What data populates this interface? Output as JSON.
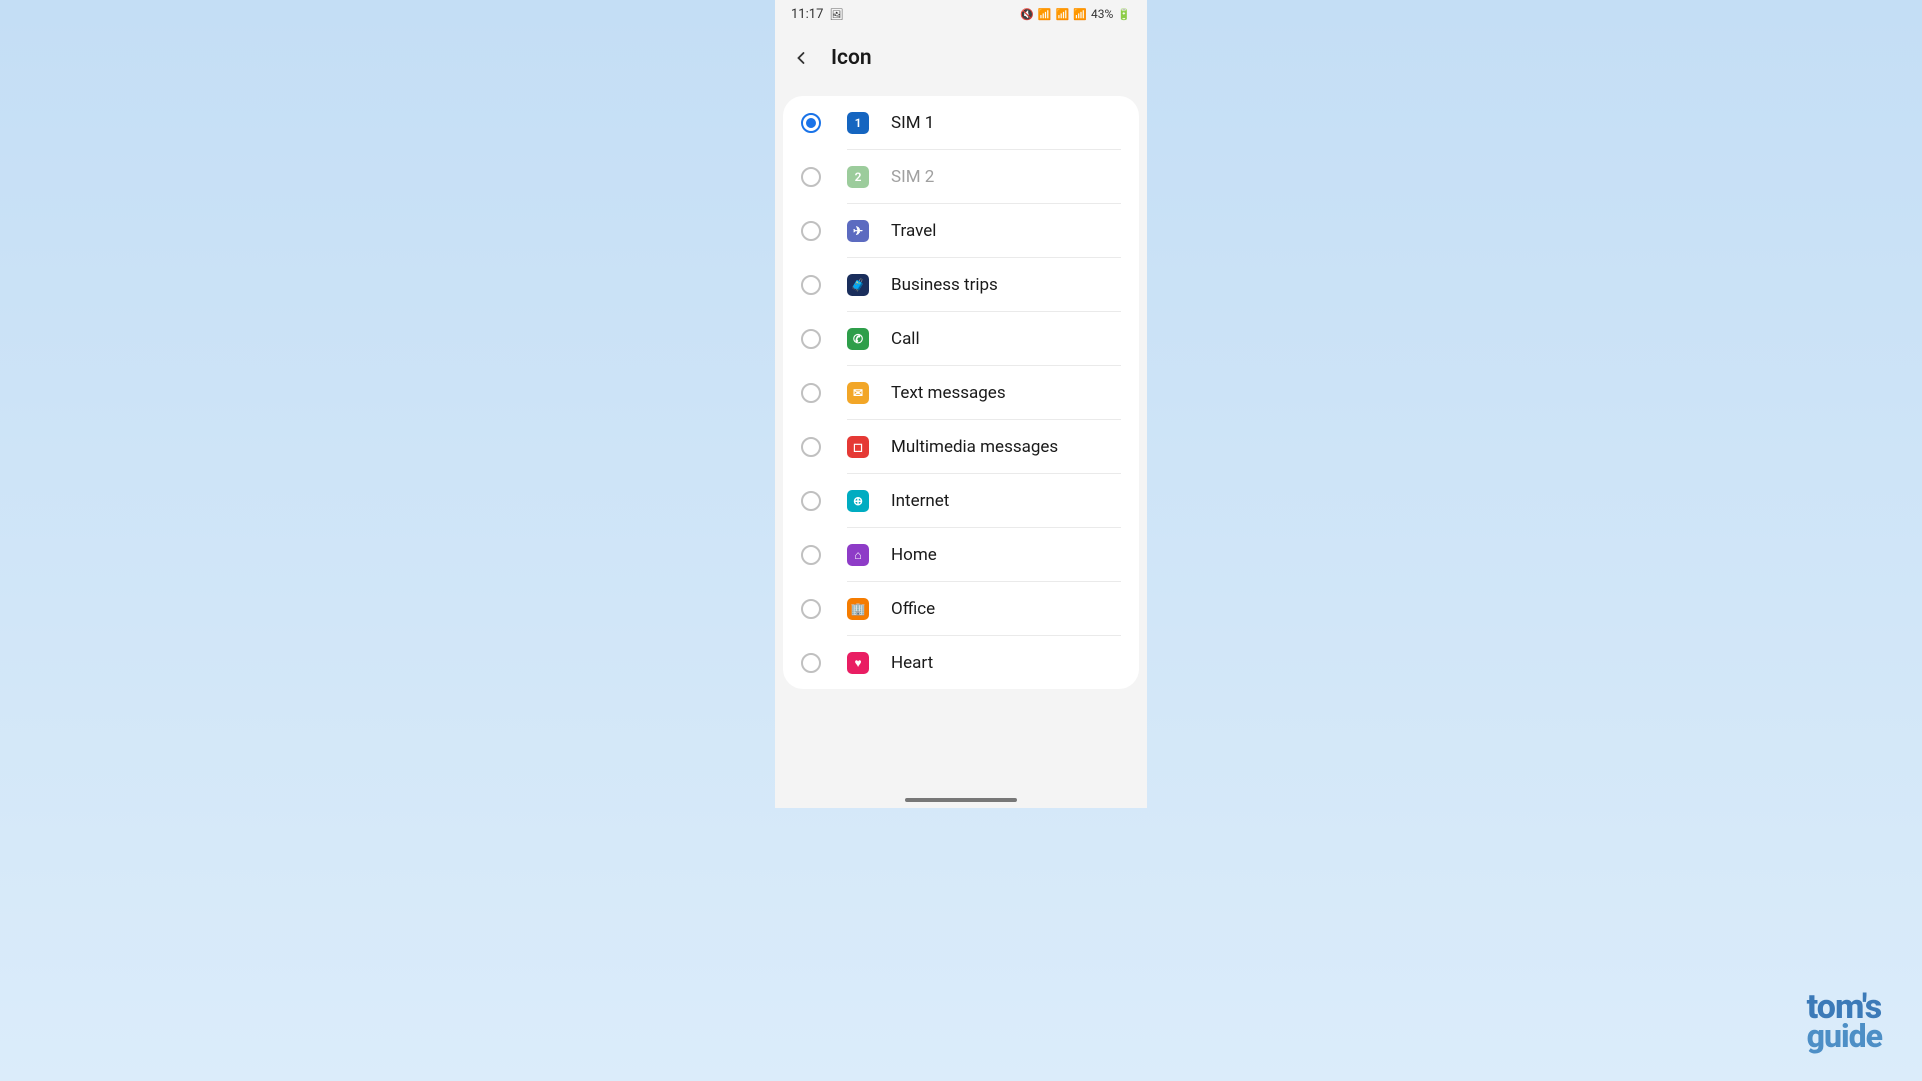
{
  "statusBar": {
    "time": "11:17",
    "battery": "43%"
  },
  "header": {
    "title": "Icon"
  },
  "items": [
    {
      "label": "SIM 1",
      "color": "#1565c0",
      "glyph": "1",
      "selected": true,
      "muted": false,
      "iconName": "sim1-icon"
    },
    {
      "label": "SIM 2",
      "color": "#9ccc9c",
      "glyph": "2",
      "selected": false,
      "muted": true,
      "iconName": "sim2-icon"
    },
    {
      "label": "Travel",
      "color": "#5c6bc0",
      "glyph": "✈",
      "selected": false,
      "muted": false,
      "iconName": "travel-icon"
    },
    {
      "label": "Business trips",
      "color": "#1a2e5c",
      "glyph": "🧳",
      "selected": false,
      "muted": false,
      "iconName": "business-trips-icon"
    },
    {
      "label": "Call",
      "color": "#2e9e4a",
      "glyph": "✆",
      "selected": false,
      "muted": false,
      "iconName": "call-icon"
    },
    {
      "label": "Text messages",
      "color": "#f2a627",
      "glyph": "✉",
      "selected": false,
      "muted": false,
      "iconName": "text-messages-icon"
    },
    {
      "label": "Multimedia messages",
      "color": "#e53935",
      "glyph": "◻",
      "selected": false,
      "muted": false,
      "iconName": "multimedia-messages-icon"
    },
    {
      "label": "Internet",
      "color": "#00acc1",
      "glyph": "⊕",
      "selected": false,
      "muted": false,
      "iconName": "internet-icon"
    },
    {
      "label": "Home",
      "color": "#8e3cc7",
      "glyph": "⌂",
      "selected": false,
      "muted": false,
      "iconName": "home-icon"
    },
    {
      "label": "Office",
      "color": "#f57c00",
      "glyph": "🏢",
      "selected": false,
      "muted": false,
      "iconName": "office-icon"
    },
    {
      "label": "Heart",
      "color": "#e91e63",
      "glyph": "♥",
      "selected": false,
      "muted": false,
      "iconName": "heart-icon"
    }
  ],
  "watermark": {
    "line1": "tom's",
    "line2": "guide"
  }
}
